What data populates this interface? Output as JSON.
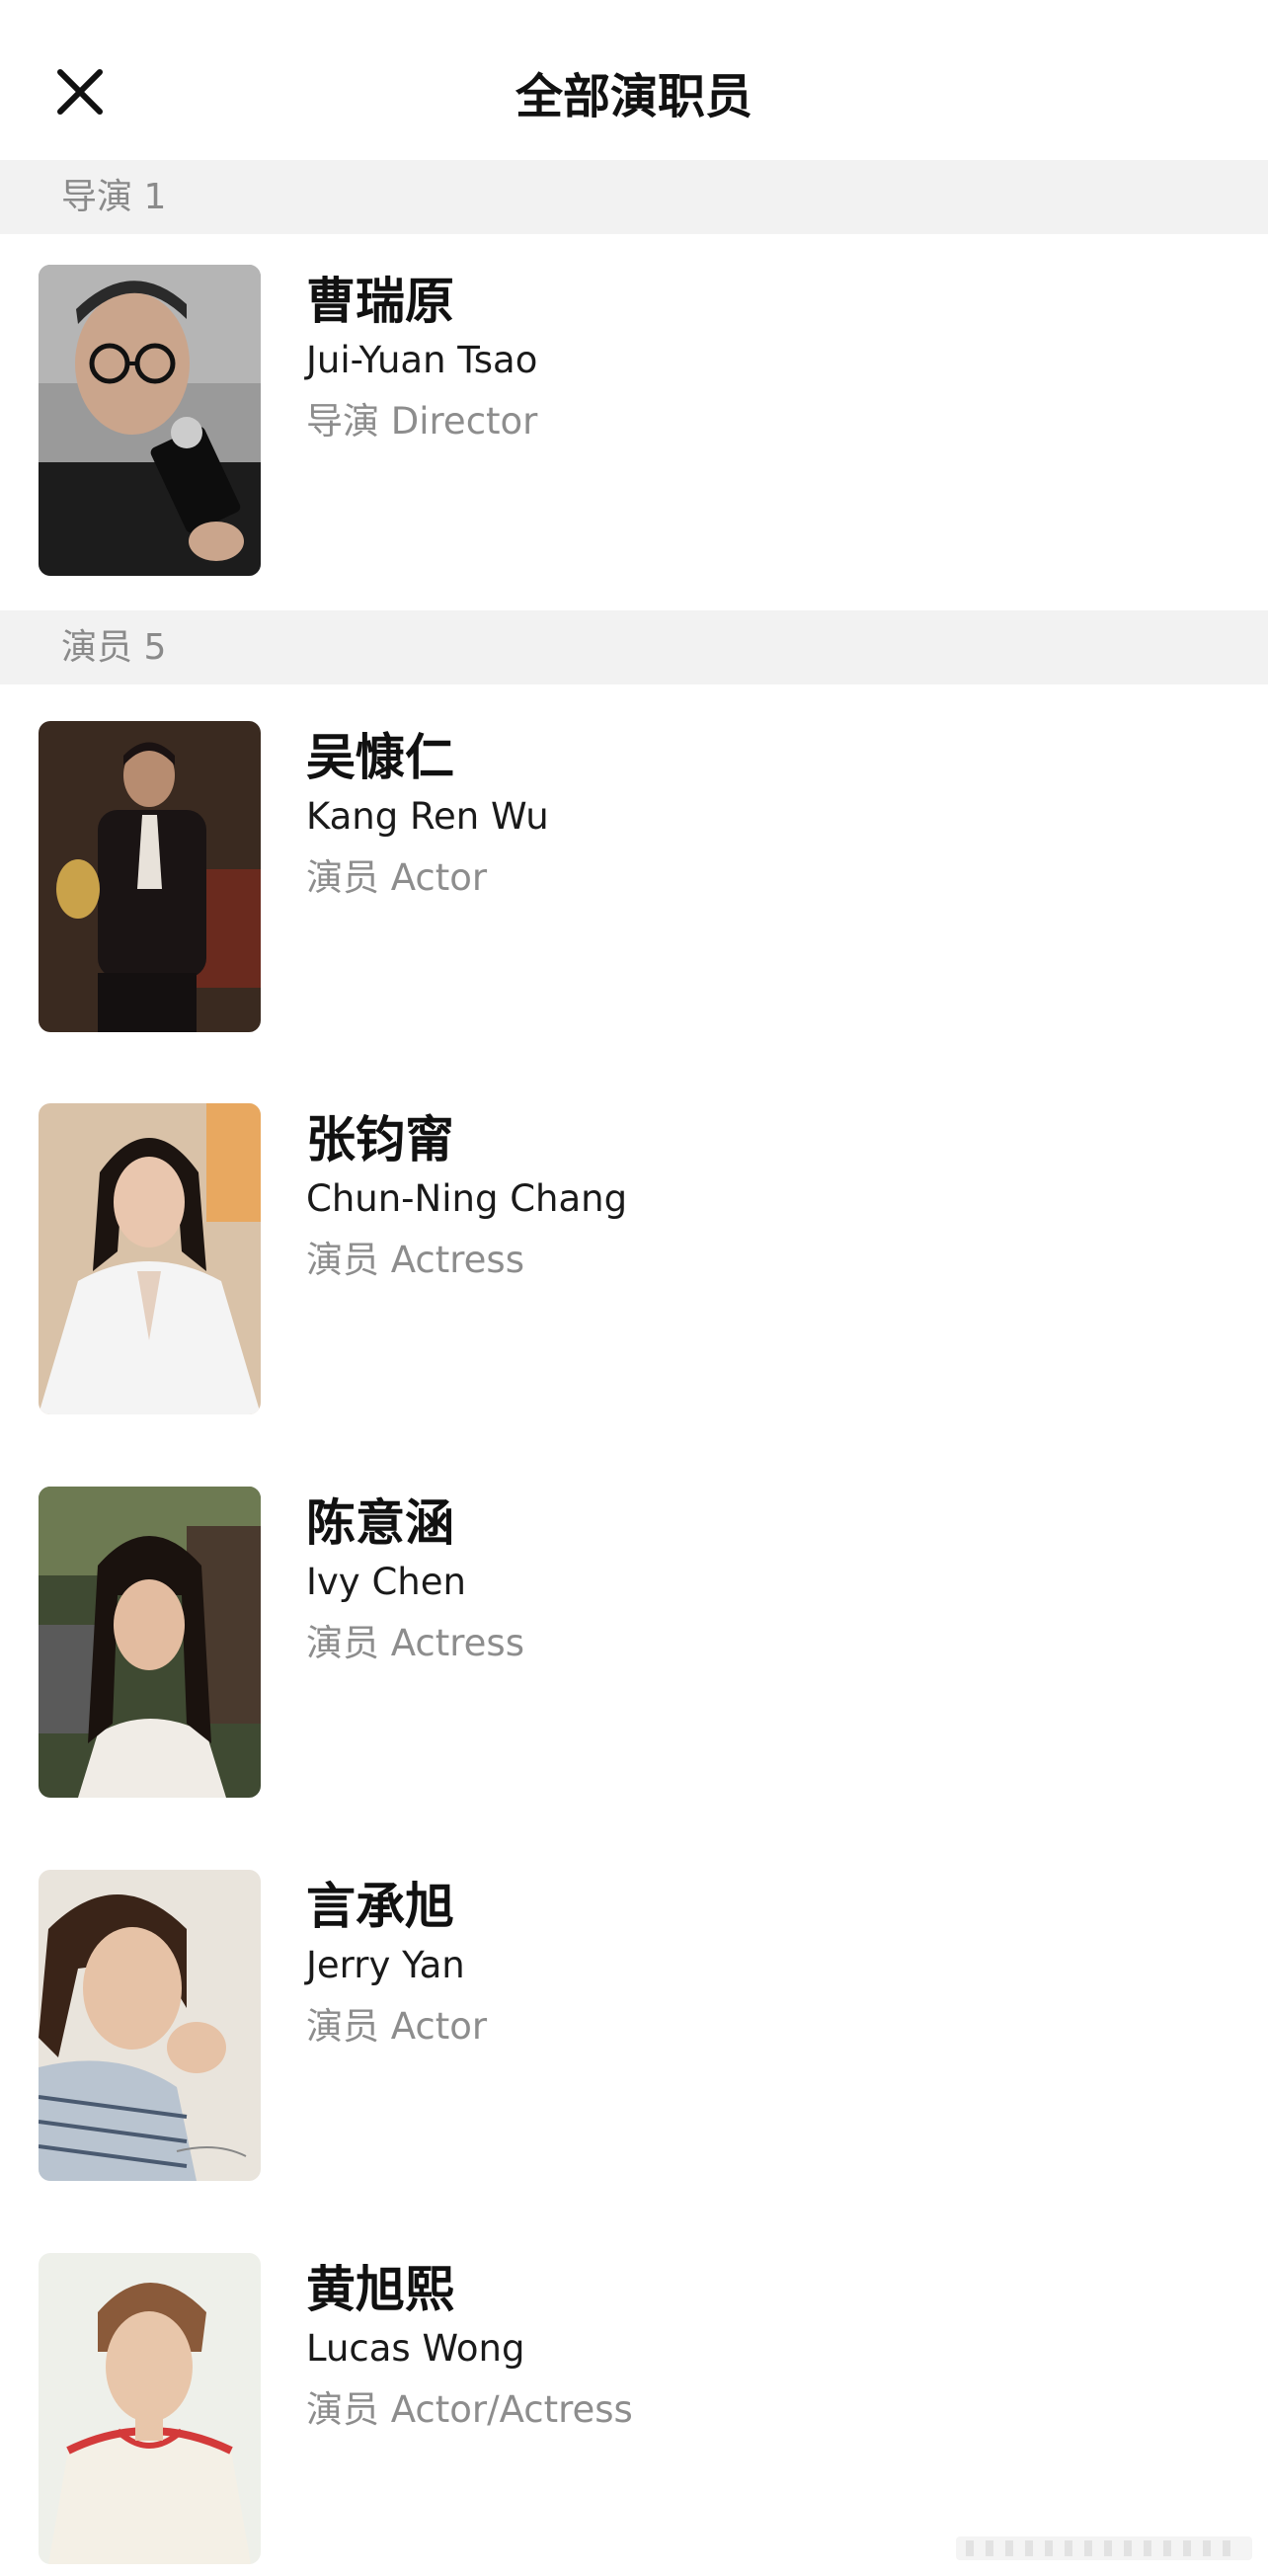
{
  "header": {
    "title": "全部演职员",
    "close_icon": "close-icon"
  },
  "sections": [
    {
      "label": "导演 1",
      "people": [
        {
          "name_zh": "曹瑞原",
          "name_en": "Jui-Yuan Tsao",
          "role": "导演 Director",
          "photo": "director-portrait"
        }
      ]
    },
    {
      "label": "演员 5",
      "people": [
        {
          "name_zh": "吴慷仁",
          "name_en": "Kang Ren Wu",
          "role": "演员 Actor",
          "photo": "actor-portrait"
        },
        {
          "name_zh": "张钧甯",
          "name_en": "Chun-Ning Chang",
          "role": "演员 Actress",
          "photo": "actress-portrait"
        },
        {
          "name_zh": "陈意涵",
          "name_en": "Ivy Chen",
          "role": "演员 Actress",
          "photo": "actress-portrait"
        },
        {
          "name_zh": "言承旭",
          "name_en": "Jerry Yan",
          "role": "演员 Actor",
          "photo": "actor-portrait"
        },
        {
          "name_zh": "黄旭熙",
          "name_en": "Lucas Wong",
          "role": "演员 Actor/Actress",
          "photo": "actor-portrait"
        }
      ]
    }
  ],
  "colors": {
    "background": "#ffffff",
    "section_bg": "#f2f2f2",
    "section_text": "#8a8a8a",
    "name_text": "#111111",
    "role_text": "#8d8d8d"
  }
}
